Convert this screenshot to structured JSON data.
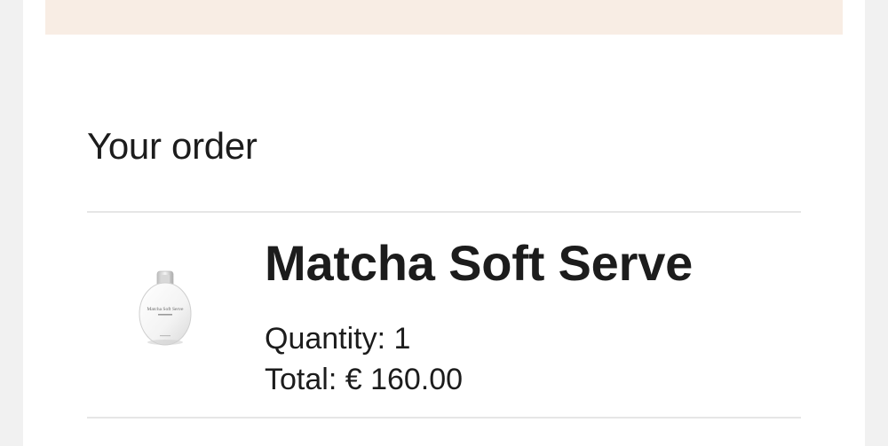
{
  "order": {
    "heading": "Your order",
    "items": [
      {
        "name": "Matcha Soft Serve",
        "quantity_label": "Quantity:",
        "quantity": "1",
        "total_label": "Total:",
        "total": "€ 160.00",
        "image": {
          "icon": "perfume-bottle-icon",
          "bottle_text": "Matcha Soft Serve"
        }
      }
    ]
  },
  "colors": {
    "banner": "#f8ede4",
    "page_background": "#f1f1f1",
    "card_background": "#ffffff",
    "text": "#1c1c1c",
    "divider": "#e6e6e6"
  }
}
